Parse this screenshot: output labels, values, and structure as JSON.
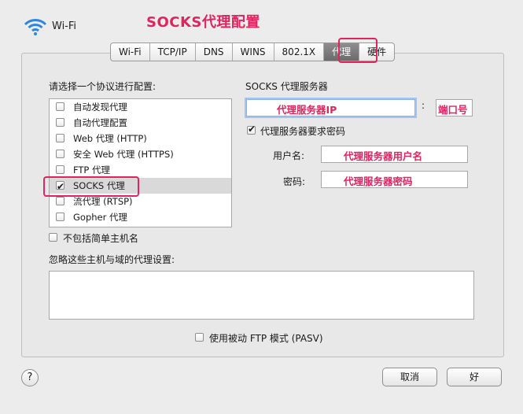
{
  "window": {
    "network_name": "Wi-Fi"
  },
  "annotation": {
    "title": "SOCKS代理配置",
    "server_ip": "代理服务器IP",
    "port": "端口号",
    "username": "代理服务器用户名",
    "password": "代理服务器密码"
  },
  "tabs": [
    "Wi-Fi",
    "TCP/IP",
    "DNS",
    "WINS",
    "802.1X",
    "代理",
    "硬件"
  ],
  "active_tab": "代理",
  "protocols": {
    "label": "请选择一个协议进行配置:",
    "items": [
      {
        "label": "自动发现代理",
        "checked": false
      },
      {
        "label": "自动代理配置",
        "checked": false
      },
      {
        "label": "Web 代理 (HTTP)",
        "checked": false
      },
      {
        "label": "安全 Web 代理 (HTTPS)",
        "checked": false
      },
      {
        "label": "FTP 代理",
        "checked": false
      },
      {
        "label": "SOCKS 代理",
        "checked": true
      },
      {
        "label": "流代理 (RTSP)",
        "checked": false
      },
      {
        "label": "Gopher 代理",
        "checked": false
      }
    ]
  },
  "exclude_simple": {
    "label": "不包括简单主机名",
    "checked": false
  },
  "bypass": {
    "label": "忽略这些主机与域的代理设置:",
    "value": ""
  },
  "server": {
    "label": "SOCKS 代理服务器",
    "colon": ":",
    "requires_password": {
      "label": "代理服务器要求密码",
      "checked": true
    },
    "username_label": "用户名:",
    "password_label": "密码:"
  },
  "pasv": {
    "label": "使用被动 FTP 模式 (PASV)",
    "checked": false
  },
  "buttons": {
    "help": "?",
    "cancel": "取消",
    "ok": "好"
  }
}
